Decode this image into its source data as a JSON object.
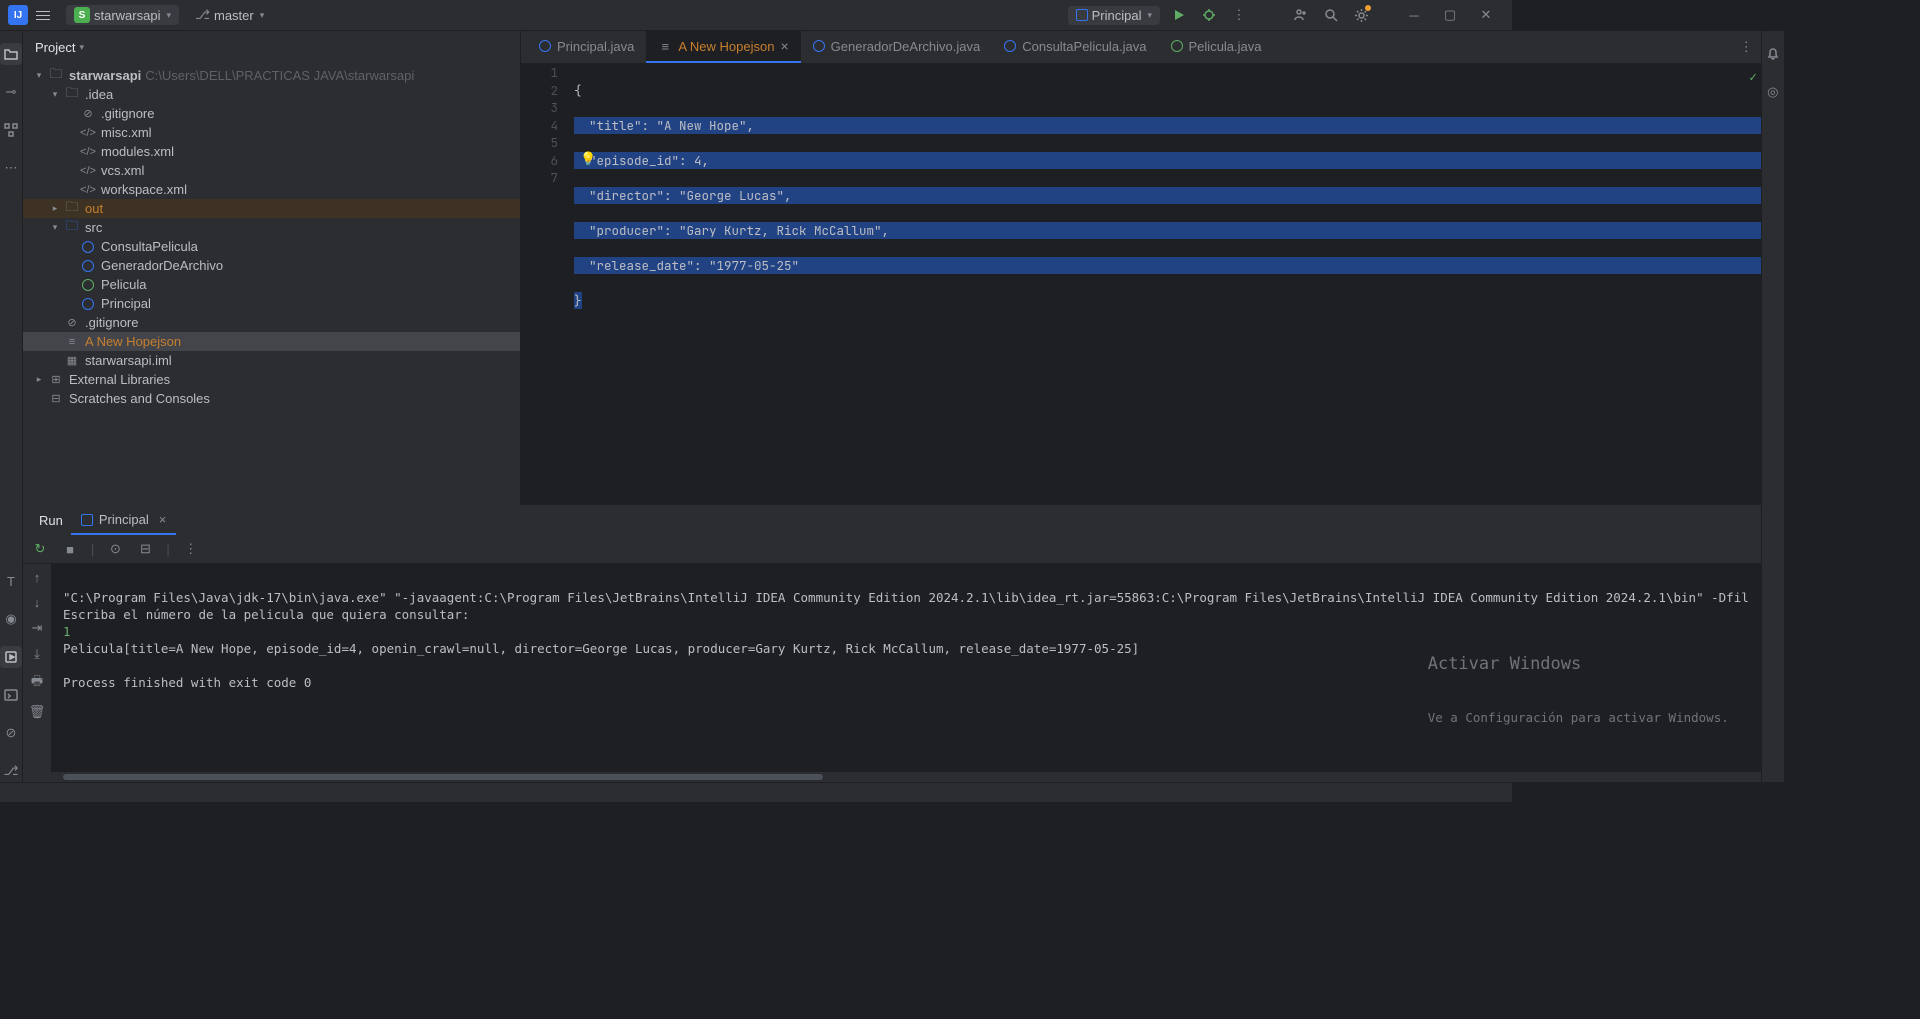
{
  "titlebar": {
    "project_name": "starwarsapi",
    "branch": "master",
    "run_config": "Principal"
  },
  "project_panel": {
    "header": "Project",
    "root": {
      "name": "starwarsapi",
      "path": "C:\\Users\\DELL\\PRACTICAS JAVA\\starwarsapi"
    },
    "idea": ".idea",
    "idea_files": [
      ".gitignore",
      "misc.xml",
      "modules.xml",
      "vcs.xml",
      "workspace.xml"
    ],
    "out": "out",
    "src": "src",
    "src_files": [
      "ConsultaPelicula",
      "GeneradorDeArchivo",
      "Pelicula",
      "Principal"
    ],
    "root_files": {
      "gitignore": ".gitignore",
      "anewhopejson": "A New Hopejson",
      "iml": "starwarsapi.iml"
    },
    "ext_lib": "External Libraries",
    "scratches": "Scratches and Consoles"
  },
  "tabs": [
    {
      "label": "Principal.java"
    },
    {
      "label": "A New Hopejson"
    },
    {
      "label": "GeneradorDeArchivo.java"
    },
    {
      "label": "ConsultaPelicula.java"
    },
    {
      "label": "Pelicula.java"
    }
  ],
  "editor": {
    "line_numbers": [
      "1",
      "2",
      "3",
      "4",
      "5",
      "6",
      "7"
    ],
    "lines": [
      "{",
      "  \"title\": \"A New Hope\",",
      "  \"episode_id\": 4,",
      "  \"director\": \"George Lucas\",",
      "  \"producer\": \"Gary Kurtz, Rick McCallum\",",
      "  \"release_date\": \"1977-05-25\"",
      "}"
    ]
  },
  "run_panel": {
    "title": "Run",
    "tab": "Principal",
    "output": {
      "l1": "\"C:\\Program Files\\Java\\jdk-17\\bin\\java.exe\" \"-javaagent:C:\\Program Files\\JetBrains\\IntelliJ IDEA Community Edition 2024.2.1\\lib\\idea_rt.jar=55863:C:\\Program Files\\JetBrains\\IntelliJ IDEA Community Edition 2024.2.1\\bin\" -Dfil",
      "l2": "Escriba el número de la pelicula que quiera consultar:",
      "l3": "1",
      "l4": "Pelicula[title=A New Hope, episode_id=4, openin_crawl=null, director=George Lucas, producer=Gary Kurtz, Rick McCallum, release_date=1977-05-25]",
      "l5": "",
      "l6": "Process finished with exit code 0"
    }
  },
  "watermark": {
    "line1": "Activar Windows",
    "line2": "Ve a Configuración para activar Windows."
  }
}
